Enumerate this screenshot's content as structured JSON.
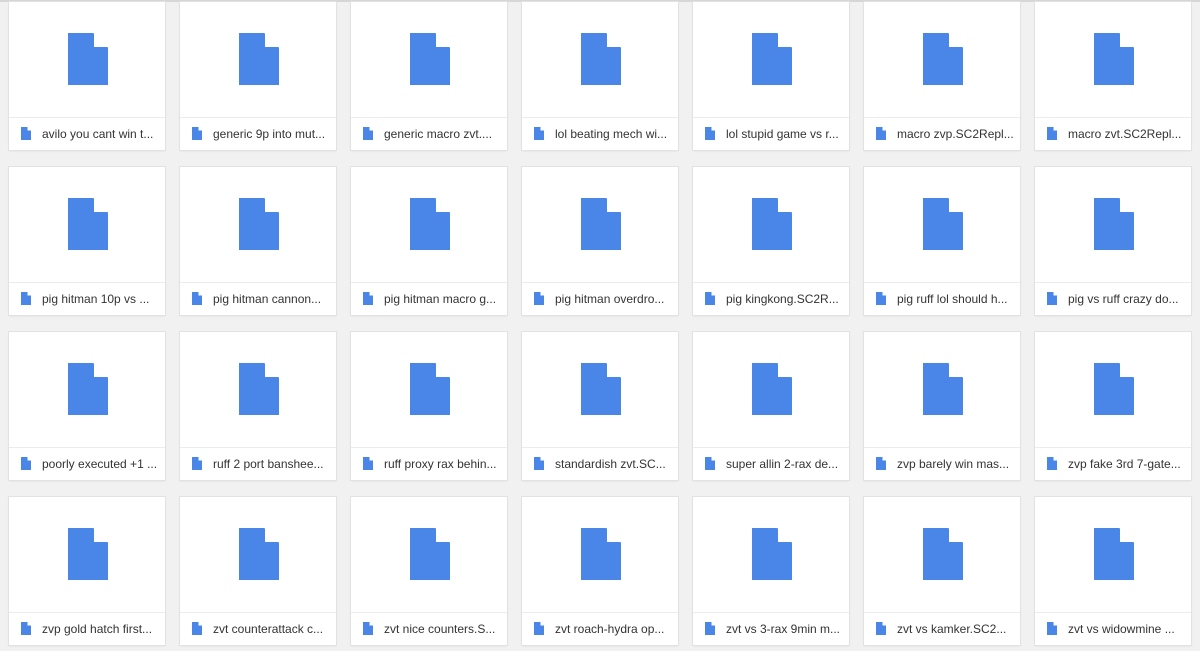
{
  "colors": {
    "doc_icon": "#4a86e8",
    "doc_fold": "#ffffff",
    "tile_bg": "#ffffff",
    "page_bg": "#f1f1f1",
    "text": "#333333"
  },
  "icons": {
    "thumbnail": "document-icon",
    "caption": "file-icon"
  },
  "files": [
    {
      "name": "avilo you cant win t..."
    },
    {
      "name": "generic 9p into mut..."
    },
    {
      "name": "generic macro zvt...."
    },
    {
      "name": "lol beating mech wi..."
    },
    {
      "name": "lol stupid game vs r..."
    },
    {
      "name": "macro zvp.SC2Repl..."
    },
    {
      "name": "macro zvt.SC2Repl..."
    },
    {
      "name": "pig hitman 10p vs ..."
    },
    {
      "name": "pig hitman cannon..."
    },
    {
      "name": "pig hitman macro g..."
    },
    {
      "name": "pig hitman overdro..."
    },
    {
      "name": "pig kingkong.SC2R..."
    },
    {
      "name": "pig ruff lol should h..."
    },
    {
      "name": "pig vs ruff crazy do..."
    },
    {
      "name": "poorly executed +1 ..."
    },
    {
      "name": "ruff 2 port banshee..."
    },
    {
      "name": "ruff proxy rax behin..."
    },
    {
      "name": "standardish zvt.SC..."
    },
    {
      "name": "super allin 2-rax de..."
    },
    {
      "name": "zvp barely win mas..."
    },
    {
      "name": "zvp fake 3rd 7-gate..."
    },
    {
      "name": "zvp gold hatch first..."
    },
    {
      "name": "zvt counterattack c..."
    },
    {
      "name": "zvt nice counters.S..."
    },
    {
      "name": "zvt roach-hydra op..."
    },
    {
      "name": "zvt vs 3-rax 9min m..."
    },
    {
      "name": "zvt vs kamker.SC2..."
    },
    {
      "name": "zvt vs widowmine ..."
    }
  ]
}
